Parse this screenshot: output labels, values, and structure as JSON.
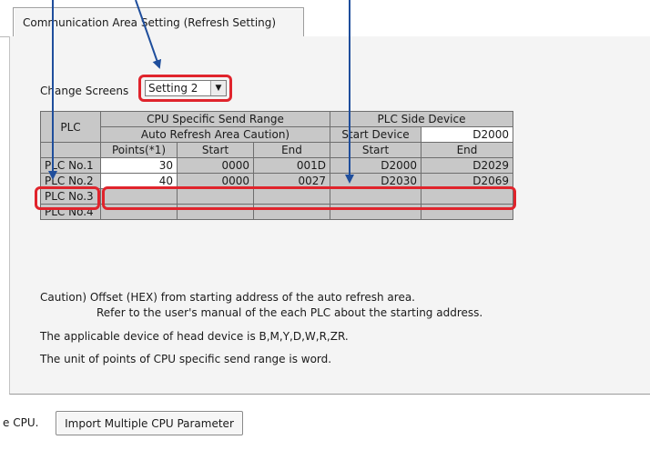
{
  "tab": {
    "label": "Communication Area Setting (Refresh Setting)"
  },
  "change_screens": {
    "label": "Change Screens",
    "value": "Setting 2"
  },
  "table": {
    "header_plc": "PLC",
    "header_cpu_range": "CPU Specific Send Range",
    "header_plc_side": "PLC Side Device",
    "header_auto_refresh": "Auto Refresh Area  Caution)",
    "header_start_device": "Start Device",
    "start_device_value": "D2000",
    "col_points": "Points(*1)",
    "col_start": "Start",
    "col_end": "End",
    "col_dev_start": "Start",
    "col_dev_end": "End",
    "rows": [
      {
        "label": "PLC No.1",
        "points": "30",
        "start": "0000",
        "end": "001D",
        "dev_start": "D2000",
        "dev_end": "D2029"
      },
      {
        "label": "PLC No.2",
        "points": "40",
        "start": "0000",
        "end": "0027",
        "dev_start": "D2030",
        "dev_end": "D2069"
      },
      {
        "label": "PLC No.3",
        "points": "",
        "start": "",
        "end": "",
        "dev_start": "",
        "dev_end": ""
      },
      {
        "label": "PLC No.4",
        "points": "",
        "start": "",
        "end": "",
        "dev_start": "",
        "dev_end": ""
      }
    ]
  },
  "notes": {
    "caution_1": "Caution) Offset (HEX) from starting address of the auto refresh area.",
    "caution_2": "Refer to the user's manual of the each PLC about the starting address.",
    "applicable": "The applicable device of head device is B,M,Y,D,W,R,ZR.",
    "unit": "The unit of points of CPU specific send range is word."
  },
  "bottom": {
    "fragment": "e CPU.",
    "import_button": "Import Multiple CPU Parameter"
  },
  "colors": {
    "highlight": "#e0242c",
    "arrow": "#1f4e9c",
    "header_gray": "#c8c8c8"
  }
}
